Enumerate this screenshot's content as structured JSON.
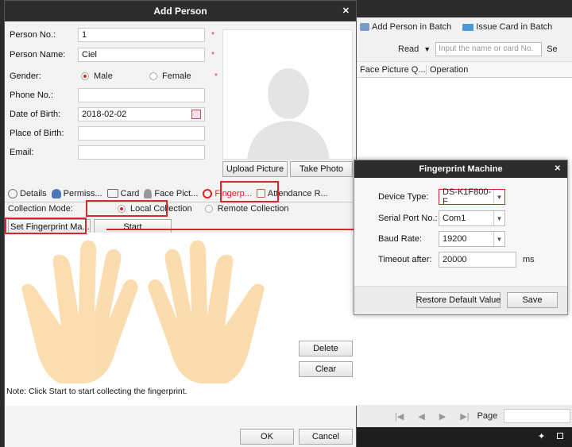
{
  "add_person": {
    "title": "Add Person",
    "fields": {
      "person_no_label": "Person No.:",
      "person_no_value": "1",
      "person_name_label": "Person Name:",
      "person_name_value": "Ciel",
      "gender_label": "Gender:",
      "gender_male": "Male",
      "gender_female": "Female",
      "gender_selected": "Male",
      "phone_label": "Phone No.:",
      "phone_value": "",
      "dob_label": "Date of Birth:",
      "dob_value": "2018-02-02",
      "pob_label": "Place of Birth:",
      "pob_value": "",
      "email_label": "Email:",
      "email_value": "",
      "required_mark": "*"
    },
    "photo_buttons": {
      "upload": "Upload Picture",
      "take": "Take Photo"
    },
    "tabs": [
      {
        "label": "Details",
        "icon": "gear-icon"
      },
      {
        "label": "Permiss...",
        "icon": "users-icon"
      },
      {
        "label": "Card",
        "icon": "card-icon"
      },
      {
        "label": "Face Pict...",
        "icon": "person-icon"
      },
      {
        "label": "Fingerp...",
        "icon": "fingerprint-icon",
        "active": true
      },
      {
        "label": "Attendance R...",
        "icon": "calendar-icon"
      }
    ],
    "collection_mode_label": "Collection Mode:",
    "local_collection": "Local Collection",
    "remote_collection": "Remote Collection",
    "set_fingerprint_button": "Set Fingerprint Ma...",
    "start_button": "Start",
    "delete_button": "Delete",
    "clear_button": "Clear",
    "note": "Note: Click Start to start collecting the fingerprint.",
    "ok_button": "OK",
    "cancel_button": "Cancel"
  },
  "background_panel": {
    "add_in_batch": "Add Person in Batch",
    "issue_card_batch": "Issue Card in Batch",
    "read_label": "Read",
    "search_placeholder": "Input the name or card No.",
    "search_suffix": "Se",
    "col_face_picture": "Face Picture Q...",
    "col_operation": "Operation",
    "page_label": "Page"
  },
  "fingerprint_machine": {
    "title": "Fingerprint Machine",
    "device_type_label": "Device Type:",
    "device_type_value": "DS-K1F800-F",
    "serial_port_label": "Serial Port No.:",
    "serial_port_value": "Com1",
    "baud_rate_label": "Baud Rate:",
    "baud_rate_value": "19200",
    "timeout_label": "Timeout after:",
    "timeout_value": "20000",
    "timeout_unit": "ms",
    "restore_button": "Restore Default Value",
    "save_button": "Save"
  },
  "colors": {
    "accent_red": "#d9262c",
    "titlebar": "#2d2d2d",
    "hand": "#fbd9a6"
  }
}
